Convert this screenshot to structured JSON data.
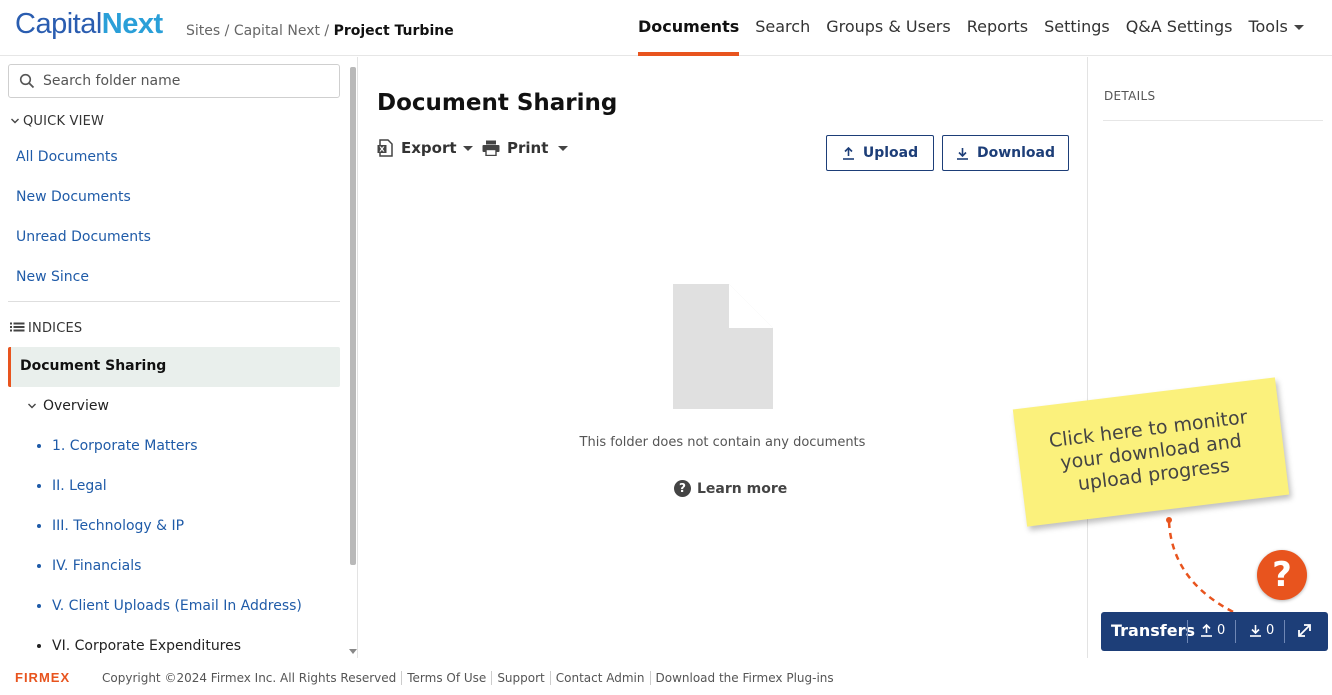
{
  "header": {
    "logo_part1": "Capital",
    "logo_part2": "Next",
    "breadcrumb": {
      "root": "Sites",
      "sep1": " / ",
      "site": "Capital Next",
      "sep2": " / ",
      "current": "Project Turbine"
    },
    "nav": [
      "Documents",
      "Search",
      "Groups & Users",
      "Reports",
      "Settings",
      "Q&A Settings",
      "Tools"
    ],
    "active_nav": "Documents"
  },
  "sidebar": {
    "search_placeholder": "Search folder name",
    "quick_view_label": "QUICK VIEW",
    "quick_view": [
      "All Documents",
      "New Documents",
      "Unread Documents",
      "New Since"
    ],
    "indices_label": "INDICES",
    "active_folder": "Document Sharing",
    "overview_label": "Overview",
    "subfolders": [
      "1. Corporate Matters",
      "II. Legal",
      "III. Technology & IP",
      "IV. Financials",
      "V. Client Uploads (Email In Address)",
      "VI. Corporate Expenditures"
    ]
  },
  "main": {
    "title": "Document Sharing",
    "export_label": "Export",
    "print_label": "Print",
    "upload_label": "Upload",
    "download_label": "Download",
    "empty_message": "This folder does not contain any documents",
    "learn_more": "Learn more"
  },
  "details": {
    "label": "DETAILS"
  },
  "note": {
    "text": "Click here to monitor your download and upload progress"
  },
  "help": {
    "label": "?"
  },
  "transfers": {
    "label": "Transfers",
    "upload_count": "0",
    "download_count": "0"
  },
  "footer": {
    "brand": "FIRMEX",
    "links": [
      "Copyright ©2024 Firmex Inc. All Rights Reserved",
      "Terms Of Use",
      "Support",
      "Contact Admin",
      "Download the Firmex Plug-ins"
    ]
  },
  "colors": {
    "accent": "#e8541e",
    "brand_navy": "#1d3e78",
    "link_blue": "#1f5ba8",
    "note_yellow": "#fbf17c"
  }
}
